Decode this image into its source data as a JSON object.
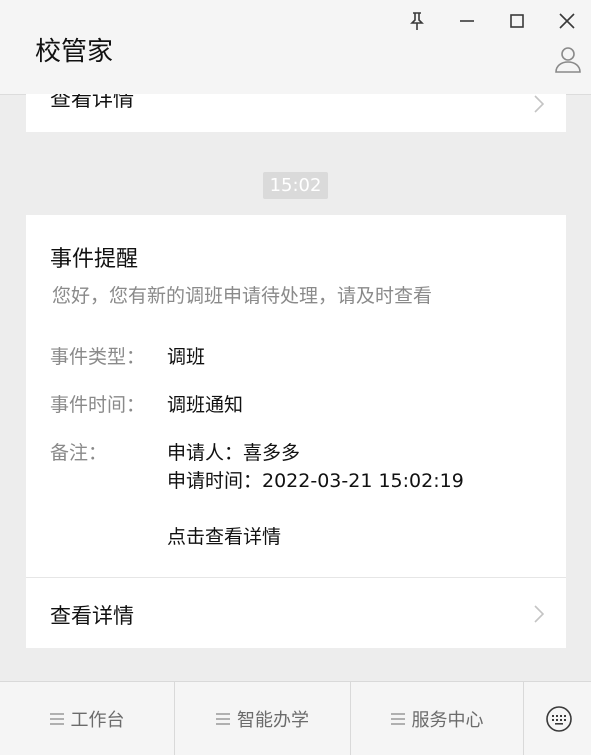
{
  "app": {
    "title": "校管家"
  },
  "window": {
    "controls": [
      "pin-icon",
      "minimize-icon",
      "maximize-icon",
      "close-icon"
    ],
    "profile_icon": "user-icon"
  },
  "previous_card": {
    "link_label": "查看详情"
  },
  "timestamp": "15:02",
  "event_card": {
    "title": "事件提醒",
    "subtitle": "您好，您有新的调班申请待处理，请及时查看",
    "fields": [
      {
        "label": "事件类型：",
        "value": "调班"
      },
      {
        "label": "事件时间：",
        "value": "调班通知"
      },
      {
        "label": "备注：",
        "value_lines": [
          "申请人：喜多多",
          "申请时间：2022-03-21 15:02:19",
          "点击查看详情"
        ]
      }
    ],
    "link_label": "查看详情"
  },
  "bottom_menu": {
    "items": [
      {
        "label": "工作台",
        "icon": "menu-icon"
      },
      {
        "label": "智能办学",
        "icon": "menu-icon"
      },
      {
        "label": "服务中心",
        "icon": "menu-icon"
      }
    ],
    "keyboard_icon": "keyboard-icon"
  },
  "colors": {
    "background": "#ededed",
    "card": "#ffffff",
    "muted_text": "#8a8a8a",
    "timestamp_bg": "#dadada"
  }
}
